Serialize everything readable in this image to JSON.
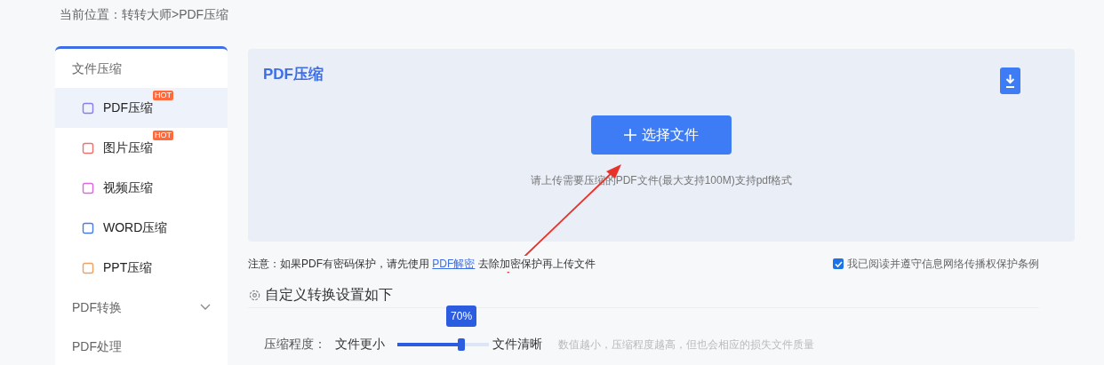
{
  "breadcrumb": "当前位置：转转大师>PDF压缩",
  "sidebar": {
    "groups": [
      {
        "label": "文件压缩",
        "kind": "open",
        "items": [
          {
            "label": "PDF压缩",
            "selected": true,
            "hot": "HOT",
            "color": "#8b7cf0"
          },
          {
            "label": "图片压缩",
            "selected": false,
            "hot": "HOT",
            "color": "#f07070"
          },
          {
            "label": "视频压缩",
            "selected": false,
            "color": "#e066e0"
          },
          {
            "label": "WORD压缩",
            "selected": false,
            "color": "#4a7be8"
          },
          {
            "label": "PPT压缩",
            "selected": false,
            "color": "#f0a060"
          }
        ]
      },
      {
        "label": "PDF转换",
        "kind": "collapsed"
      },
      {
        "label": "PDF处理",
        "kind": "plain"
      }
    ]
  },
  "upload": {
    "title": "PDF压缩",
    "button": "选择文件",
    "hint": "请上传需要压缩的PDF文件(最大支持100M)支持pdf格式"
  },
  "notice": {
    "text": "注意：如果PDF有密码保护，请先使用",
    "link": "PDF解密",
    "after": "去除加密保护再上传文件"
  },
  "agreement": {
    "label": "我已阅读并遵守信息网络传播权保护条例",
    "checked": true
  },
  "settings": {
    "title": "自定义转换设置如下",
    "label": "压缩程度：",
    "min_label": "文件更小",
    "max_label": "文件清晰",
    "tooltip": "70%",
    "level": 0.7,
    "hint": "数值越小，压缩程度越高，但也会相应的损失文件质量"
  }
}
